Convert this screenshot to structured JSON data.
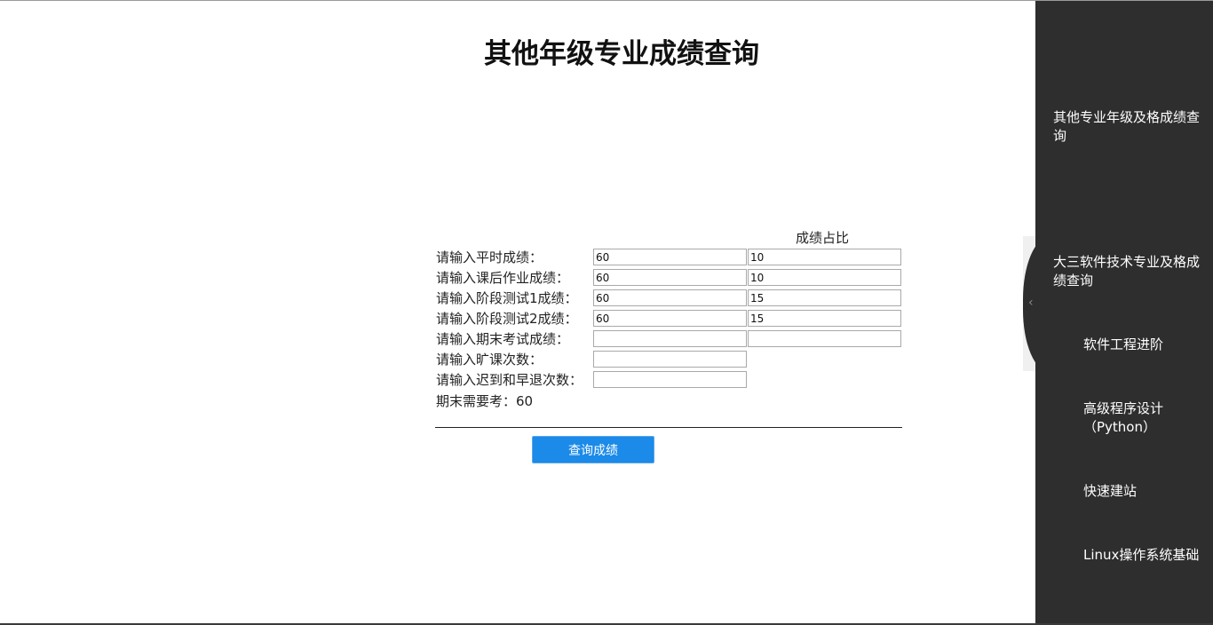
{
  "page": {
    "title": "其他年级专业成绩查询"
  },
  "form": {
    "ratio_header": "成绩占比",
    "rows": [
      {
        "label": "请输入平时成绩：",
        "score": "60",
        "ratio": "10"
      },
      {
        "label": "请输入课后作业成绩：",
        "score": "60",
        "ratio": "10"
      },
      {
        "label": "请输入阶段测试1成绩：",
        "score": "60",
        "ratio": "15"
      },
      {
        "label": "请输入阶段测试2成绩：",
        "score": "60",
        "ratio": "15"
      },
      {
        "label": "请输入期末考试成绩：",
        "score": "",
        "ratio": ""
      },
      {
        "label": "请输入旷课次数：",
        "score": ""
      },
      {
        "label": "请输入迟到和早退次数：",
        "score": ""
      }
    ],
    "final_need": "期末需要考：60",
    "query_button": "查询成绩"
  },
  "sidebar": {
    "items": [
      {
        "label": "其他专业年级及格成绩查询"
      },
      {
        "label": "大三软件技术专业及格成绩查询"
      },
      {
        "label": "软件工程进阶"
      },
      {
        "label": "高级程序设计（Python）"
      },
      {
        "label": "快速建站"
      },
      {
        "label": "Linux操作系统基础"
      }
    ],
    "collapse_icon": "chevron-left-icon"
  },
  "colors": {
    "sidebar_bg": "#2e2e2e",
    "button_bg": "#1b8ae8",
    "button_text": "#ffffff"
  }
}
